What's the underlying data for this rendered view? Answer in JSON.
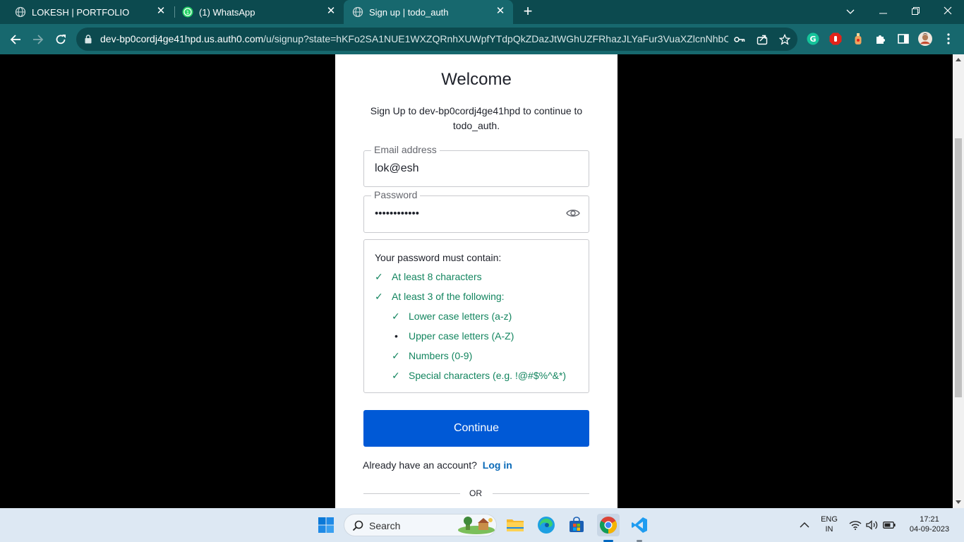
{
  "browser": {
    "tabs": [
      {
        "title": "LOKESH | PORTFOLIO",
        "icon": "globe-icon",
        "active": false
      },
      {
        "title": "(1) WhatsApp",
        "icon": "whatsapp-icon",
        "active": false
      },
      {
        "title": "Sign up | todo_auth",
        "icon": "globe-icon",
        "active": true
      }
    ],
    "url_host": "dev-bp0cordj4ge41hpd.us.auth0.com",
    "url_path": "/u/signup?state=hKFo2SA1NUE1WXZQRnhXUWpfYTdpQkZDazJtWGhUZFRhazJLYaFur3VuaXZlcnNhbC1s..."
  },
  "signup": {
    "title": "Welcome",
    "subtitle": "Sign Up to dev-bp0cordj4ge41hpd to continue to todo_auth.",
    "email_label": "Email address",
    "email_value": "lok@esh",
    "password_label": "Password",
    "password_value": "••••••••••••",
    "rules_heading": "Your password must contain:",
    "rules": [
      {
        "text": "At least 8 characters",
        "met": true,
        "level": 0
      },
      {
        "text": "At least 3 of the following:",
        "met": true,
        "level": 0
      },
      {
        "text": "Lower case letters (a-z)",
        "met": true,
        "level": 1
      },
      {
        "text": "Upper case letters (A-Z)",
        "met": false,
        "level": 1
      },
      {
        "text": "Numbers (0-9)",
        "met": true,
        "level": 1
      },
      {
        "text": "Special characters (e.g. !@#$%^&*)",
        "met": true,
        "level": 1
      }
    ],
    "check_mark": "✓",
    "bullet_mark": "•",
    "continue_label": "Continue",
    "already_text": "Already have an account?",
    "login_label": "Log in",
    "or_label": "OR"
  },
  "taskbar": {
    "search_label": "Search",
    "lang_top": "ENG",
    "lang_bottom": "IN",
    "time": "17:21",
    "date": "04-09-2023"
  },
  "colors": {
    "chrome_dark": "#0c4a4f",
    "chrome_toolbar": "#17686e",
    "primary_button": "#0059d6",
    "rule_met": "#13855f",
    "link": "#0a6ab8"
  }
}
